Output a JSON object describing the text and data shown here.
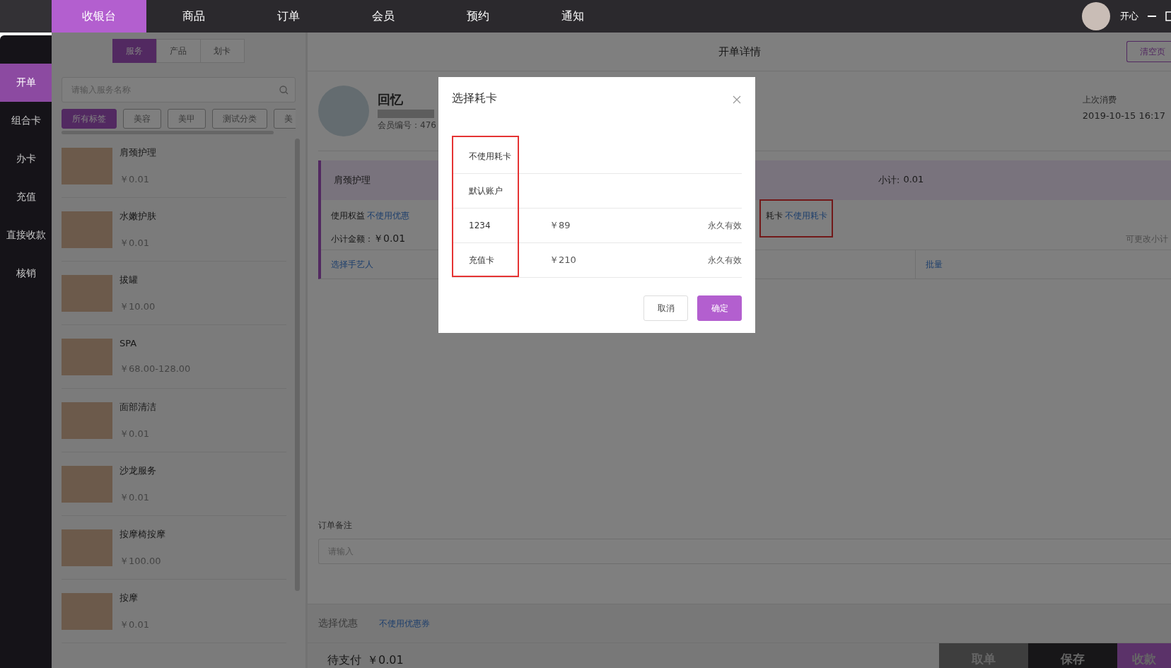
{
  "top_nav": {
    "tabs": [
      {
        "label": "收银台",
        "selected": true
      },
      {
        "label": "商品",
        "selected": false
      },
      {
        "label": "订单",
        "selected": false
      },
      {
        "label": "会员",
        "selected": false
      },
      {
        "label": "预约",
        "selected": false
      },
      {
        "label": "通知",
        "selected": false
      }
    ],
    "user": {
      "name": "开心"
    }
  },
  "sidebar": {
    "items": [
      {
        "label": "开单",
        "selected": true
      },
      {
        "label": "组合卡",
        "selected": false
      },
      {
        "label": "办卡",
        "selected": false
      },
      {
        "label": "充值",
        "selected": false
      },
      {
        "label": "直接收款",
        "selected": false
      },
      {
        "label": "核销",
        "selected": false
      }
    ]
  },
  "catalog": {
    "tabs": [
      {
        "label": "服务",
        "selected": true
      },
      {
        "label": "产品",
        "selected": false
      },
      {
        "label": "划卡",
        "selected": false
      }
    ],
    "search": {
      "placeholder": "请输入服务名称"
    },
    "tags": [
      {
        "label": "所有标签",
        "selected": true
      },
      {
        "label": "美容",
        "selected": false
      },
      {
        "label": "美甲",
        "selected": false
      },
      {
        "label": "测试分类",
        "selected": false
      },
      {
        "label": "美",
        "selected": false
      }
    ],
    "items": [
      {
        "name": "肩颈护理",
        "price": "￥0.01"
      },
      {
        "name": "水嫩护肤",
        "price": "￥0.01"
      },
      {
        "name": "拔罐",
        "price": "￥10.00"
      },
      {
        "name": "SPA",
        "price": "￥68.00-128.00"
      },
      {
        "name": "面部清洁",
        "price": "￥0.01"
      },
      {
        "name": "沙龙服务",
        "price": "￥0.01"
      },
      {
        "name": "按摩椅按摩",
        "price": "￥100.00"
      },
      {
        "name": "按摩",
        "price": "￥0.01"
      }
    ]
  },
  "order": {
    "title": "开单详情",
    "clear_button": "清空页",
    "member": {
      "name": "回忆",
      "number": "会员编号：476",
      "last_visit_label": "上次消费",
      "last_visit": "2019-10-15 16:17"
    },
    "line": {
      "name": "肩颈护理",
      "subtotal_label": "小计:",
      "subtotal": "0.01",
      "benefit_label": "使用权益",
      "benefit": "不使用优惠",
      "card_label": "耗卡",
      "card": "不使用耗卡",
      "card_annotated": true,
      "amount_label": "小计金额：",
      "amount": "￥0.01",
      "hint": "可更改小计",
      "staff": "选择手艺人",
      "batch": "批量"
    },
    "remark": {
      "label": "订单备注",
      "placeholder": "请输入"
    },
    "discount": {
      "label": "选择优惠",
      "value": "不使用优惠券"
    },
    "due": {
      "label": "待支付",
      "amount": "￥0.01"
    },
    "actions": [
      {
        "label": "取单",
        "kind": "dark"
      },
      {
        "label": "保存",
        "kind": "black"
      },
      {
        "label": "收款",
        "kind": "primary"
      }
    ]
  },
  "dialog": {
    "title": "选择耗卡",
    "first_column_annotated": true,
    "rows": [
      {
        "name": "不使用耗卡"
      },
      {
        "name": "默认账户"
      },
      {
        "name": "1234",
        "balance": "￥89",
        "validity": "永久有效"
      },
      {
        "name": "充值卡",
        "balance": "￥210",
        "validity": "永久有效"
      }
    ],
    "buttons": [
      {
        "label": "取消",
        "kind": "secondary"
      },
      {
        "label": "确定",
        "kind": "primary"
      }
    ]
  }
}
